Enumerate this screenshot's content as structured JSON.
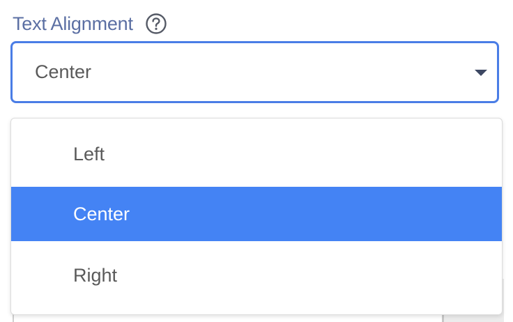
{
  "field": {
    "label": "Text Alignment",
    "help_icon": "question-circle-icon",
    "selected_value": "Center",
    "caret_icon": "caret-down-icon"
  },
  "dropdown": {
    "options": [
      {
        "label": "Left",
        "selected": false
      },
      {
        "label": "Center",
        "selected": true
      },
      {
        "label": "Right",
        "selected": false
      }
    ]
  },
  "colors": {
    "label": "#5b6fa3",
    "focus_border": "#4a7de6",
    "selected_option_bg": "#4483f4",
    "selected_option_text": "#ffffff",
    "option_text": "#5a5a5a"
  }
}
